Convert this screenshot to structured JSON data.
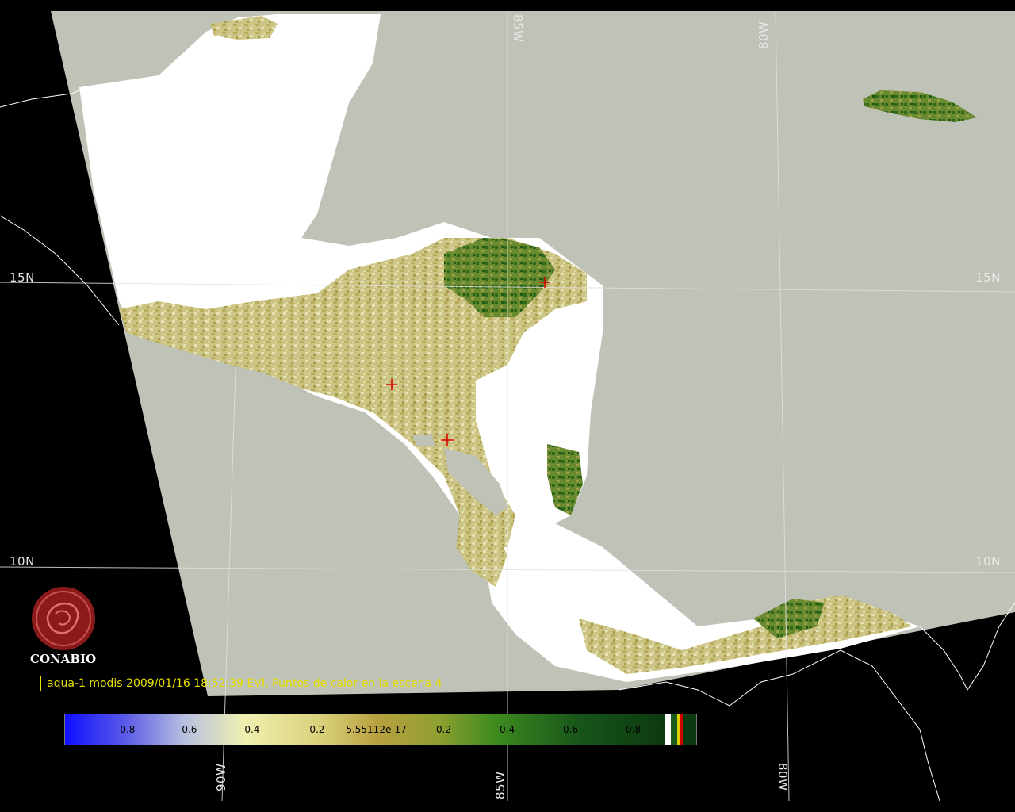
{
  "map": {
    "lat_labels": [
      "15N",
      "10N"
    ],
    "lon_labels_top": [
      "85W",
      "80W"
    ],
    "lon_labels_bottom": [
      "90W",
      "85W",
      "80W"
    ],
    "colors": {
      "background": "#000000",
      "swath": "#bec2b7",
      "cloud": "#ffffff",
      "vegetation_low": "#c9c07a",
      "vegetation_high": "#3f7a22",
      "grid": "#e0e0e0",
      "hotspot": "#e00000",
      "caption": "#e6e000",
      "logo": "#8b1a1a"
    }
  },
  "caption": {
    "text": "aqua-1 modis 2009/01/16 18:52:39 EVI, Puntos de calor en la escena 4"
  },
  "legend": {
    "ticks": [
      "-0.8",
      "-0.6",
      "-0.4",
      "-0.2",
      "-5.55112e-17",
      "0.2",
      "0.4",
      "0.6",
      "0.8"
    ]
  },
  "logo": {
    "text": "CONABIO",
    "icon": "conabio-seal-icon"
  }
}
